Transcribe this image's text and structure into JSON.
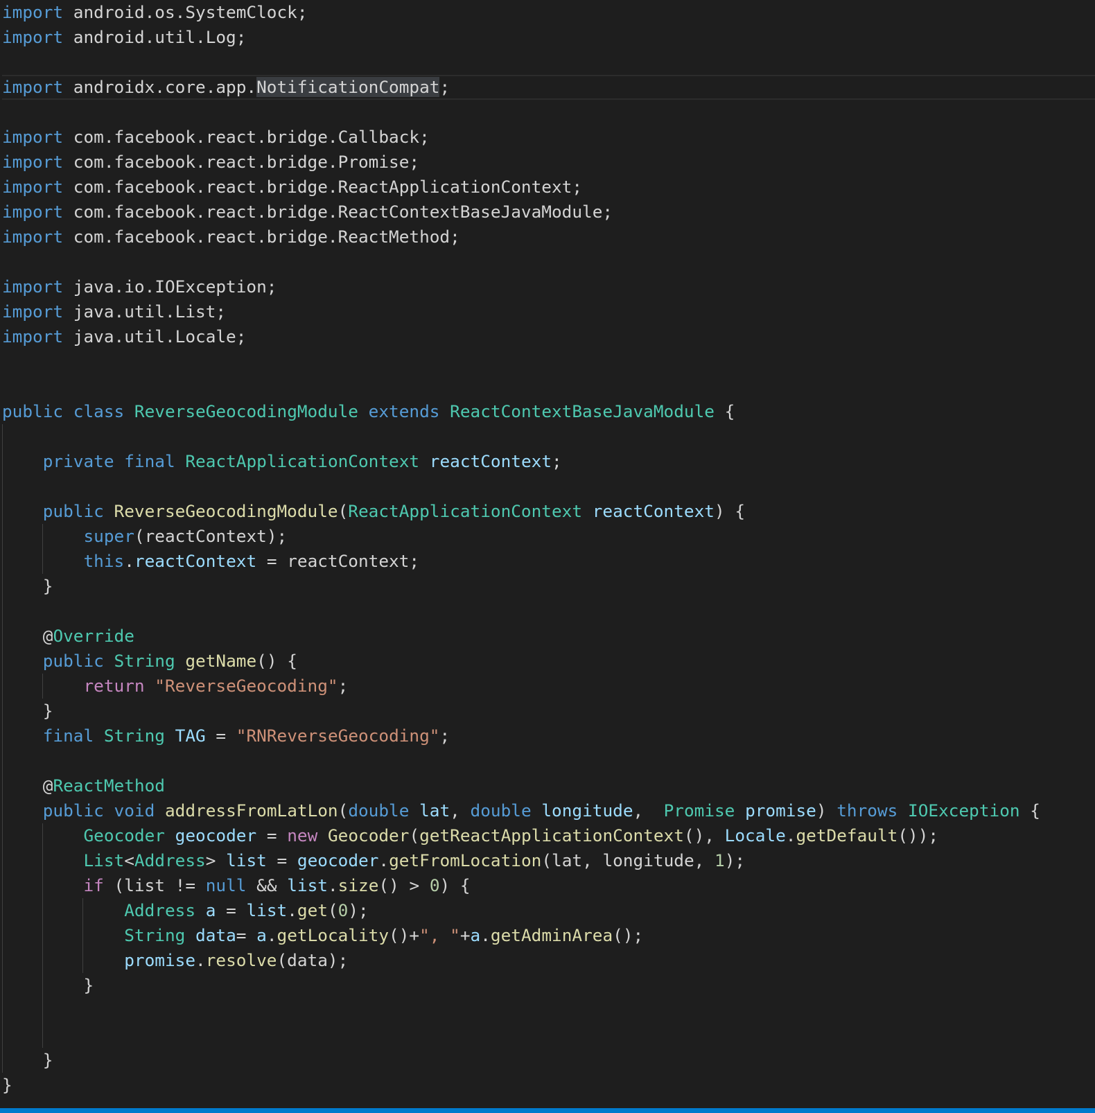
{
  "editor": {
    "language": "java",
    "theme": "dark",
    "current_line": 3,
    "highlighted_token": "NotificationCompat",
    "colors": {
      "background": "#1e1e1e",
      "keyword": "#569cd6",
      "control": "#c586c0",
      "type": "#4ec9b0",
      "function": "#dcdcaa",
      "variable": "#9cdcfe",
      "string": "#ce9178",
      "number": "#b5cea8",
      "plain": "#d4d4d4",
      "status_bar": "#007acc"
    },
    "lines": [
      [
        [
          "kw",
          "import"
        ],
        [
          "p",
          " android.os.SystemClock;"
        ]
      ],
      [
        [
          "kw",
          "import"
        ],
        [
          "p",
          " android.util.Log;"
        ]
      ],
      [],
      [
        [
          "kw",
          "import"
        ],
        [
          "p",
          " androidx.core.app."
        ],
        [
          "hl",
          "NotificationCompat"
        ],
        [
          "p",
          ";"
        ]
      ],
      [],
      [
        [
          "kw",
          "import"
        ],
        [
          "p",
          " com.facebook.react.bridge.Callback;"
        ]
      ],
      [
        [
          "kw",
          "import"
        ],
        [
          "p",
          " com.facebook.react.bridge.Promise;"
        ]
      ],
      [
        [
          "kw",
          "import"
        ],
        [
          "p",
          " com.facebook.react.bridge.ReactApplicationContext;"
        ]
      ],
      [
        [
          "kw",
          "import"
        ],
        [
          "p",
          " com.facebook.react.bridge.ReactContextBaseJavaModule;"
        ]
      ],
      [
        [
          "kw",
          "import"
        ],
        [
          "p",
          " com.facebook.react.bridge.ReactMethod;"
        ]
      ],
      [],
      [
        [
          "kw",
          "import"
        ],
        [
          "p",
          " java.io.IOException;"
        ]
      ],
      [
        [
          "kw",
          "import"
        ],
        [
          "p",
          " java.util.List;"
        ]
      ],
      [
        [
          "kw",
          "import"
        ],
        [
          "p",
          " java.util.Locale;"
        ]
      ],
      [],
      [],
      [
        [
          "kw",
          "public"
        ],
        [
          "p",
          " "
        ],
        [
          "kw",
          "class"
        ],
        [
          "p",
          " "
        ],
        [
          "type",
          "ReverseGeocodingModule"
        ],
        [
          "p",
          " "
        ],
        [
          "kw",
          "extends"
        ],
        [
          "p",
          " "
        ],
        [
          "type",
          "ReactContextBaseJavaModule"
        ],
        [
          "p",
          " {"
        ]
      ],
      [],
      [
        [
          "p",
          "    "
        ],
        [
          "kw",
          "private"
        ],
        [
          "p",
          " "
        ],
        [
          "kw",
          "final"
        ],
        [
          "p",
          " "
        ],
        [
          "type",
          "ReactApplicationContext"
        ],
        [
          "p",
          " "
        ],
        [
          "var",
          "reactContext"
        ],
        [
          "p",
          ";"
        ]
      ],
      [],
      [
        [
          "p",
          "    "
        ],
        [
          "kw",
          "public"
        ],
        [
          "p",
          " "
        ],
        [
          "fn",
          "ReverseGeocodingModule"
        ],
        [
          "p",
          "("
        ],
        [
          "type",
          "ReactApplicationContext"
        ],
        [
          "p",
          " "
        ],
        [
          "var",
          "reactContext"
        ],
        [
          "p",
          ") {"
        ]
      ],
      [
        [
          "p",
          "        "
        ],
        [
          "kw",
          "super"
        ],
        [
          "p",
          "(reactContext);"
        ]
      ],
      [
        [
          "p",
          "        "
        ],
        [
          "kw",
          "this"
        ],
        [
          "p",
          "."
        ],
        [
          "var",
          "reactContext"
        ],
        [
          "p",
          " = reactContext;"
        ]
      ],
      [
        [
          "p",
          "    }"
        ]
      ],
      [],
      [
        [
          "p",
          "    @"
        ],
        [
          "type",
          "Override"
        ]
      ],
      [
        [
          "p",
          "    "
        ],
        [
          "kw",
          "public"
        ],
        [
          "p",
          " "
        ],
        [
          "type",
          "String"
        ],
        [
          "p",
          " "
        ],
        [
          "fn",
          "getName"
        ],
        [
          "p",
          "() {"
        ]
      ],
      [
        [
          "p",
          "        "
        ],
        [
          "ctrl",
          "return"
        ],
        [
          "p",
          " "
        ],
        [
          "str",
          "\"ReverseGeocoding\""
        ],
        [
          "p",
          ";"
        ]
      ],
      [
        [
          "p",
          "    }"
        ]
      ],
      [
        [
          "p",
          "    "
        ],
        [
          "kw",
          "final"
        ],
        [
          "p",
          " "
        ],
        [
          "type",
          "String"
        ],
        [
          "p",
          " "
        ],
        [
          "var",
          "TAG"
        ],
        [
          "p",
          " = "
        ],
        [
          "str",
          "\"RNReverseGeocoding\""
        ],
        [
          "p",
          ";"
        ]
      ],
      [],
      [
        [
          "p",
          "    @"
        ],
        [
          "type",
          "ReactMethod"
        ]
      ],
      [
        [
          "p",
          "    "
        ],
        [
          "kw",
          "public"
        ],
        [
          "p",
          " "
        ],
        [
          "kw",
          "void"
        ],
        [
          "p",
          " "
        ],
        [
          "fn",
          "addressFromLatLon"
        ],
        [
          "p",
          "("
        ],
        [
          "kw",
          "double"
        ],
        [
          "p",
          " "
        ],
        [
          "var",
          "lat"
        ],
        [
          "p",
          ", "
        ],
        [
          "kw",
          "double"
        ],
        [
          "p",
          " "
        ],
        [
          "var",
          "longitude"
        ],
        [
          "p",
          ",  "
        ],
        [
          "type",
          "Promise"
        ],
        [
          "p",
          " "
        ],
        [
          "var",
          "promise"
        ],
        [
          "p",
          ") "
        ],
        [
          "kw",
          "throws"
        ],
        [
          "p",
          " "
        ],
        [
          "type",
          "IOException"
        ],
        [
          "p",
          " {"
        ]
      ],
      [
        [
          "p",
          "        "
        ],
        [
          "type",
          "Geocoder"
        ],
        [
          "p",
          " "
        ],
        [
          "var",
          "geocoder"
        ],
        [
          "p",
          " = "
        ],
        [
          "ctrl",
          "new"
        ],
        [
          "p",
          " "
        ],
        [
          "fn",
          "Geocoder"
        ],
        [
          "p",
          "("
        ],
        [
          "fn",
          "getReactApplicationContext"
        ],
        [
          "p",
          "(), "
        ],
        [
          "var",
          "Locale"
        ],
        [
          "p",
          "."
        ],
        [
          "fn",
          "getDefault"
        ],
        [
          "p",
          "());"
        ]
      ],
      [
        [
          "p",
          "        "
        ],
        [
          "type",
          "List"
        ],
        [
          "p",
          "<"
        ],
        [
          "type",
          "Address"
        ],
        [
          "p",
          "> "
        ],
        [
          "var",
          "list"
        ],
        [
          "p",
          " = "
        ],
        [
          "var",
          "geocoder"
        ],
        [
          "p",
          "."
        ],
        [
          "fn",
          "getFromLocation"
        ],
        [
          "p",
          "(lat, longitude, "
        ],
        [
          "num",
          "1"
        ],
        [
          "p",
          ");"
        ]
      ],
      [
        [
          "p",
          "        "
        ],
        [
          "ctrl",
          "if"
        ],
        [
          "p",
          " (list != "
        ],
        [
          "kw",
          "null"
        ],
        [
          "p",
          " && "
        ],
        [
          "var",
          "list"
        ],
        [
          "p",
          "."
        ],
        [
          "fn",
          "size"
        ],
        [
          "p",
          "() > "
        ],
        [
          "num",
          "0"
        ],
        [
          "p",
          ") {"
        ]
      ],
      [
        [
          "p",
          "            "
        ],
        [
          "type",
          "Address"
        ],
        [
          "p",
          " "
        ],
        [
          "var",
          "a"
        ],
        [
          "p",
          " = "
        ],
        [
          "var",
          "list"
        ],
        [
          "p",
          "."
        ],
        [
          "fn",
          "get"
        ],
        [
          "p",
          "("
        ],
        [
          "num",
          "0"
        ],
        [
          "p",
          ");"
        ]
      ],
      [
        [
          "p",
          "            "
        ],
        [
          "type",
          "String"
        ],
        [
          "p",
          " "
        ],
        [
          "var",
          "data"
        ],
        [
          "p",
          "= "
        ],
        [
          "var",
          "a"
        ],
        [
          "p",
          "."
        ],
        [
          "fn",
          "getLocality"
        ],
        [
          "p",
          "()+"
        ],
        [
          "str",
          "\", \""
        ],
        [
          "p",
          "+"
        ],
        [
          "var",
          "a"
        ],
        [
          "p",
          "."
        ],
        [
          "fn",
          "getAdminArea"
        ],
        [
          "p",
          "();"
        ]
      ],
      [
        [
          "p",
          "            "
        ],
        [
          "var",
          "promise"
        ],
        [
          "p",
          "."
        ],
        [
          "fn",
          "resolve"
        ],
        [
          "p",
          "(data);"
        ]
      ],
      [
        [
          "p",
          "        }"
        ]
      ],
      [],
      [],
      [
        [
          "p",
          "    }"
        ]
      ],
      [
        [
          "p",
          "}"
        ]
      ]
    ]
  }
}
